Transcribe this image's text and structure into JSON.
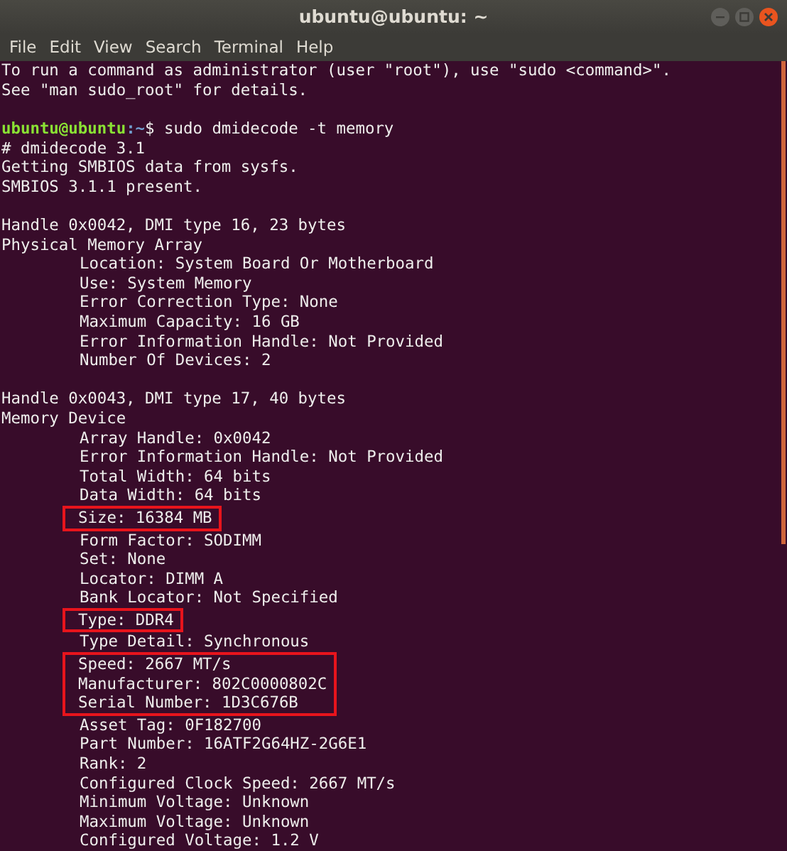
{
  "window": {
    "title": "ubuntu@ubuntu: ~"
  },
  "menu": [
    "File",
    "Edit",
    "View",
    "Search",
    "Terminal",
    "Help"
  ],
  "terminal": {
    "blocks": [
      {
        "kind": "plain",
        "lines": [
          {
            "kind": "text",
            "text": "To run a command as administrator (user \"root\"), use \"sudo <command>\"."
          },
          {
            "kind": "text",
            "text": "See \"man sudo_root\" for details."
          },
          {
            "kind": "blank"
          },
          {
            "kind": "prompt",
            "user": "ubuntu@ubuntu",
            "path": ":~",
            "command": "$ sudo dmidecode -t memory"
          },
          {
            "kind": "text",
            "text": "# dmidecode 3.1"
          },
          {
            "kind": "text",
            "text": "Getting SMBIOS data from sysfs."
          },
          {
            "kind": "text",
            "text": "SMBIOS 3.1.1 present."
          },
          {
            "kind": "blank"
          },
          {
            "kind": "text",
            "text": "Handle 0x0042, DMI type 16, 23 bytes"
          },
          {
            "kind": "text",
            "text": "Physical Memory Array"
          },
          {
            "kind": "text",
            "indented": true,
            "text": "Location: System Board Or Motherboard"
          },
          {
            "kind": "text",
            "indented": true,
            "text": "Use: System Memory"
          },
          {
            "kind": "text",
            "indented": true,
            "text": "Error Correction Type: None"
          },
          {
            "kind": "text",
            "indented": true,
            "text": "Maximum Capacity: 16 GB"
          },
          {
            "kind": "text",
            "indented": true,
            "text": "Error Information Handle: Not Provided"
          },
          {
            "kind": "text",
            "indented": true,
            "text": "Number Of Devices: 2"
          },
          {
            "kind": "blank"
          },
          {
            "kind": "text",
            "text": "Handle 0x0043, DMI type 17, 40 bytes"
          },
          {
            "kind": "text",
            "text": "Memory Device"
          },
          {
            "kind": "text",
            "indented": true,
            "text": "Array Handle: 0x0042"
          },
          {
            "kind": "text",
            "indented": true,
            "text": "Error Information Handle: Not Provided"
          },
          {
            "kind": "text",
            "indented": true,
            "text": "Total Width: 64 bits"
          },
          {
            "kind": "text",
            "indented": true,
            "text": "Data Width: 64 bits"
          }
        ]
      },
      {
        "kind": "highlight",
        "lines": [
          {
            "kind": "text",
            "text": "Size: 16384 MB"
          }
        ]
      },
      {
        "kind": "plain",
        "lines": [
          {
            "kind": "text",
            "indented": true,
            "text": "Form Factor: SODIMM"
          },
          {
            "kind": "text",
            "indented": true,
            "text": "Set: None"
          },
          {
            "kind": "text",
            "indented": true,
            "text": "Locator: DIMM A"
          },
          {
            "kind": "text",
            "indented": true,
            "text": "Bank Locator: Not Specified"
          }
        ]
      },
      {
        "kind": "highlight",
        "lines": [
          {
            "kind": "text",
            "text": "Type: DDR4"
          }
        ]
      },
      {
        "kind": "plain",
        "lines": [
          {
            "kind": "text",
            "indented": true,
            "text": "Type Detail: Synchronous"
          }
        ]
      },
      {
        "kind": "highlight",
        "lines": [
          {
            "kind": "text",
            "text": "Speed: 2667 MT/s"
          },
          {
            "kind": "text",
            "text": "Manufacturer: 802C0000802C"
          },
          {
            "kind": "text",
            "text": "Serial Number: 1D3C676B"
          }
        ]
      },
      {
        "kind": "plain",
        "lines": [
          {
            "kind": "text",
            "indented": true,
            "text": "Asset Tag: 0F182700"
          },
          {
            "kind": "text",
            "indented": true,
            "text": "Part Number: 16ATF2G64HZ-2G6E1"
          },
          {
            "kind": "text",
            "indented": true,
            "text": "Rank: 2"
          },
          {
            "kind": "text",
            "indented": true,
            "text": "Configured Clock Speed: 2667 MT/s"
          },
          {
            "kind": "text",
            "indented": true,
            "text": "Minimum Voltage: Unknown"
          },
          {
            "kind": "text",
            "indented": true,
            "text": "Maximum Voltage: Unknown"
          },
          {
            "kind": "text",
            "indented": true,
            "text": "Configured Voltage: 1.2 V"
          }
        ]
      }
    ]
  }
}
